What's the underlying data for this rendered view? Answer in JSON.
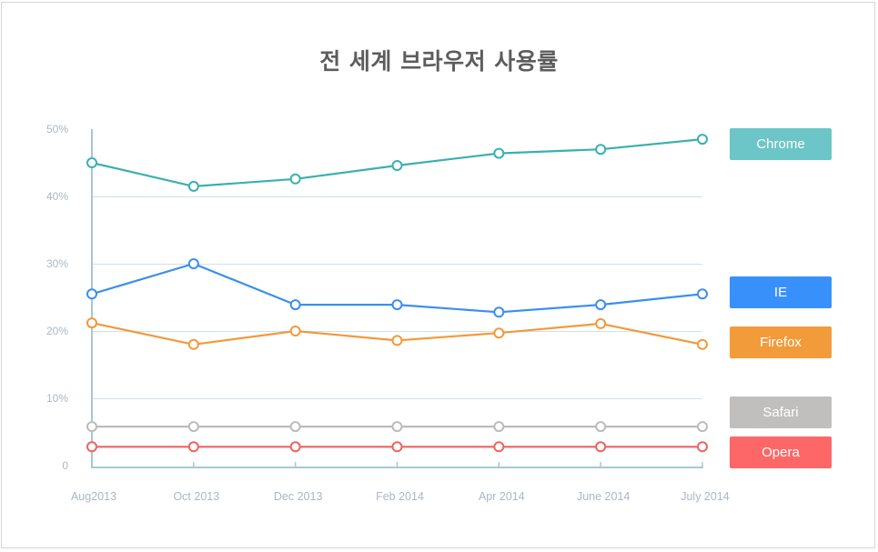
{
  "chart_data": {
    "type": "line",
    "title": "전 세계 브라우저 사용률",
    "xlabel": "",
    "ylabel": "",
    "x": [
      "Aug2013",
      "Oct 2013",
      "Dec 2013",
      "Feb 2014",
      "Apr 2014",
      "June 2014",
      "July 2014"
    ],
    "ylim": [
      0,
      50
    ],
    "yticks": [
      0,
      10,
      20,
      30,
      40,
      50
    ],
    "ytick_labels": [
      "0",
      "10%",
      "20%",
      "30%",
      "40%",
      "50%"
    ],
    "grid": true,
    "legend_position": "right",
    "series": [
      {
        "name": "Chrome",
        "color": "#3ab0b0",
        "legend_color": "#6cc5c6",
        "values": [
          45.0,
          41.5,
          42.6,
          44.6,
          46.4,
          47.0,
          48.5
        ]
      },
      {
        "name": "IE",
        "color": "#3a8fef",
        "legend_color": "#3891fb",
        "values": [
          25.5,
          30.0,
          23.9,
          23.9,
          22.8,
          23.9,
          25.5
        ]
      },
      {
        "name": "Firefox",
        "color": "#f3993b",
        "legend_color": "#f29b3b",
        "values": [
          21.2,
          18.0,
          20.0,
          18.6,
          19.7,
          21.1,
          18.0
        ]
      },
      {
        "name": "Safari",
        "color": "#bdbbbb",
        "legend_color": "#c1bebe",
        "values": [
          5.8,
          5.8,
          5.8,
          5.8,
          5.8,
          5.8,
          5.8
        ]
      },
      {
        "name": "Opera",
        "color": "#f06262",
        "legend_color": "#fd6767",
        "values": [
          2.8,
          2.8,
          2.8,
          2.8,
          2.8,
          2.8,
          2.8
        ]
      }
    ]
  },
  "colors": {
    "axis": "#a6c7d8",
    "grid": "#cfe1ea",
    "tick_text": "#a8b8c4",
    "title": "#5d5d5d"
  }
}
